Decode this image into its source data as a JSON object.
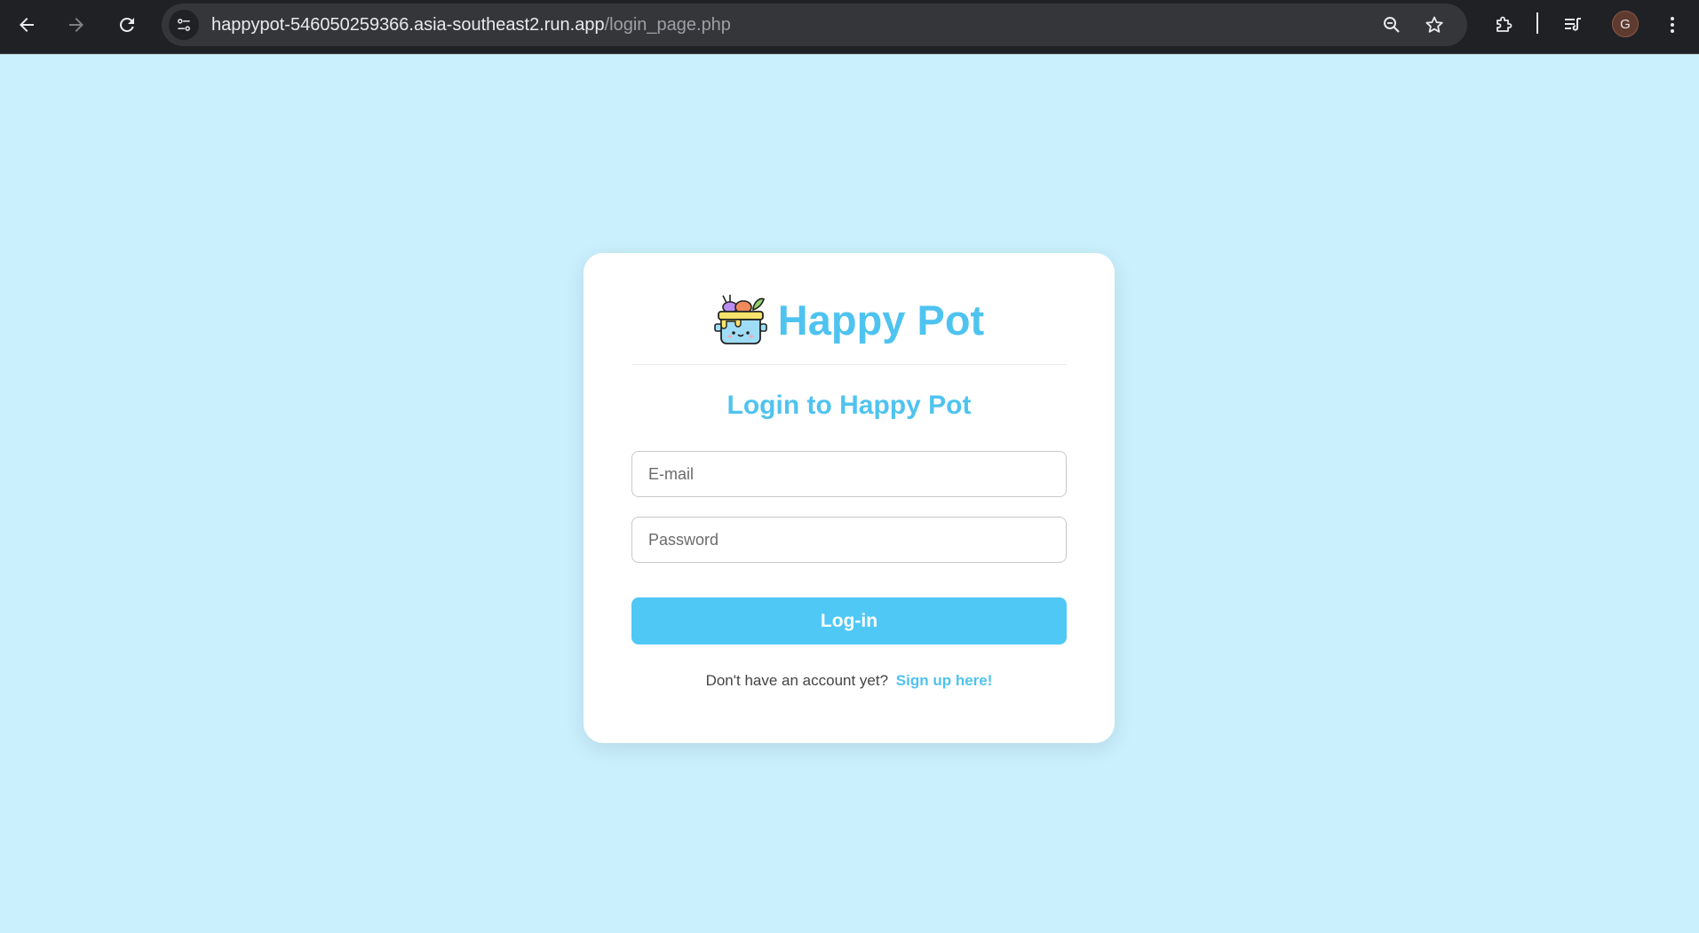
{
  "browser": {
    "url_host": "happypot-546050259366.asia-southeast2.run.app",
    "url_path": "/login_page.php",
    "profile_initial": "G",
    "icons": [
      "back-icon",
      "forward-icon",
      "reload-icon",
      "site-info-icon",
      "zoom-icon",
      "bookmark-star-icon",
      "extensions-icon",
      "media-queue-icon",
      "kebab-menu-icon"
    ]
  },
  "brand": {
    "name": "Happy Pot",
    "logo_icon": "happy-pot-logo-icon"
  },
  "login": {
    "title": "Login to Happy Pot",
    "email_placeholder": "E-mail",
    "password_placeholder": "Password",
    "submit_label": "Log-in",
    "signup_prompt": "Don't have an account yet?",
    "signup_link": "Sign up here!"
  },
  "colors": {
    "page_background": "#caf0fd",
    "accent": "#4fc3f0",
    "button": "#4fc8f5",
    "card": "#ffffff",
    "chrome": "#202124"
  }
}
